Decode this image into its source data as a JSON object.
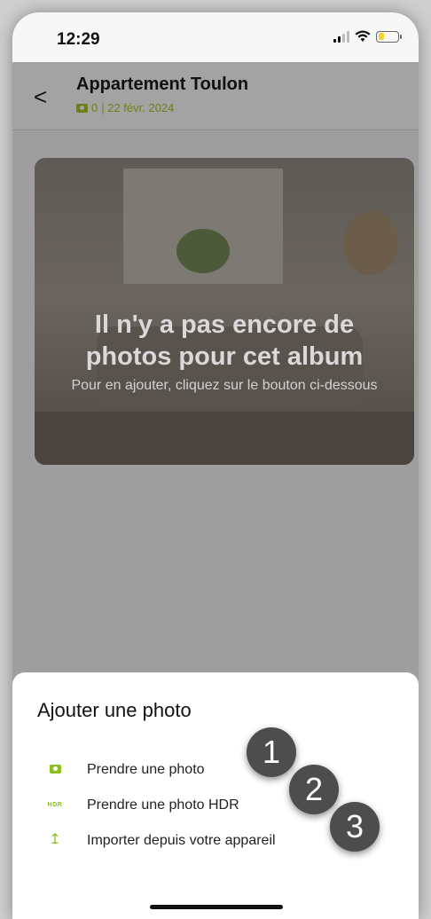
{
  "status_bar": {
    "time": "12:29"
  },
  "header": {
    "back_label": "<",
    "title": "Appartement Toulon",
    "photo_count": "0",
    "date": "| 22 févr. 2024"
  },
  "empty_state": {
    "title": "Il n'y a pas encore de photos pour cet album",
    "subtitle": "Pour en ajouter, cliquez sur le bouton ci-dessous"
  },
  "sheet": {
    "title": "Ajouter une photo",
    "options": [
      {
        "label": "Prendre une photo",
        "icon": "camera-icon",
        "icon_text": ""
      },
      {
        "label": "Prendre une photo HDR",
        "icon": "hdr-icon",
        "icon_text": "HDR"
      },
      {
        "label": "Importer depuis votre appareil",
        "icon": "upload-icon",
        "icon_text": "↥"
      }
    ]
  },
  "badges": [
    "1",
    "2",
    "3"
  ],
  "colors": {
    "accent": "#8bbf1e",
    "badge": "#4d4d4d",
    "battery": "#f2d233"
  }
}
